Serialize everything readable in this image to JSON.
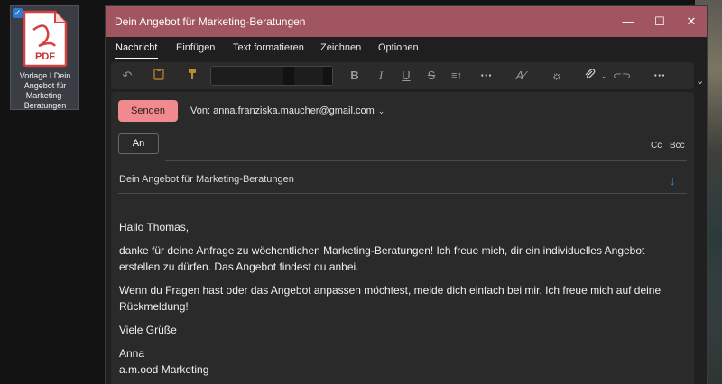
{
  "desktop": {
    "icon_label": "Vorlage I Dein Angebot für Marketing-Beratungen",
    "pdf_text": "PDF"
  },
  "window": {
    "title": "Dein Angebot für Marketing-Beratungen",
    "controls": {
      "minimize": "—",
      "maximize": "☐",
      "close": "✕"
    }
  },
  "menu": {
    "items": [
      "Nachricht",
      "Einfügen",
      "Text formatieren",
      "Zeichnen",
      "Optionen"
    ],
    "active": "Nachricht"
  },
  "toolbar": {
    "icons": [
      "undo-icon",
      "clipboard-icon",
      "format-painter-icon",
      "bold-icon",
      "italic-icon",
      "underline-icon",
      "strikethrough-icon",
      "line-spacing-icon",
      "more-icon",
      "styles-icon",
      "theme-icon",
      "attach-icon",
      "link-icon",
      "more-icon"
    ]
  },
  "compose": {
    "send_label": "Senden",
    "from_label": "Von: anna.franziska.maucher@gmail.com",
    "to_label": "An",
    "cc_label": "Cc",
    "bcc_label": "Bcc",
    "subject": "Dein Angebot für Marketing-Beratungen"
  },
  "message": {
    "greeting": "Hallo Thomas,",
    "paragraph1": "danke für deine Anfrage zu wöchentlichen Marketing-Beratungen! Ich freue mich, dir ein individuelles Angebot erstellen zu dürfen. Das Angebot findest du anbei.",
    "paragraph2": "Wenn du Fragen hast oder das Angebot anpassen möchtest, melde dich einfach bei mir. Ich freue mich auf deine Rückmeldung!",
    "closing": "Viele Grüße",
    "signature_name": "Anna",
    "signature_company": "a.m.ood Marketing"
  },
  "colors": {
    "titlebar": "#a05560",
    "send_button": "#f08a8f",
    "accent_blue": "#3b8fe0"
  }
}
